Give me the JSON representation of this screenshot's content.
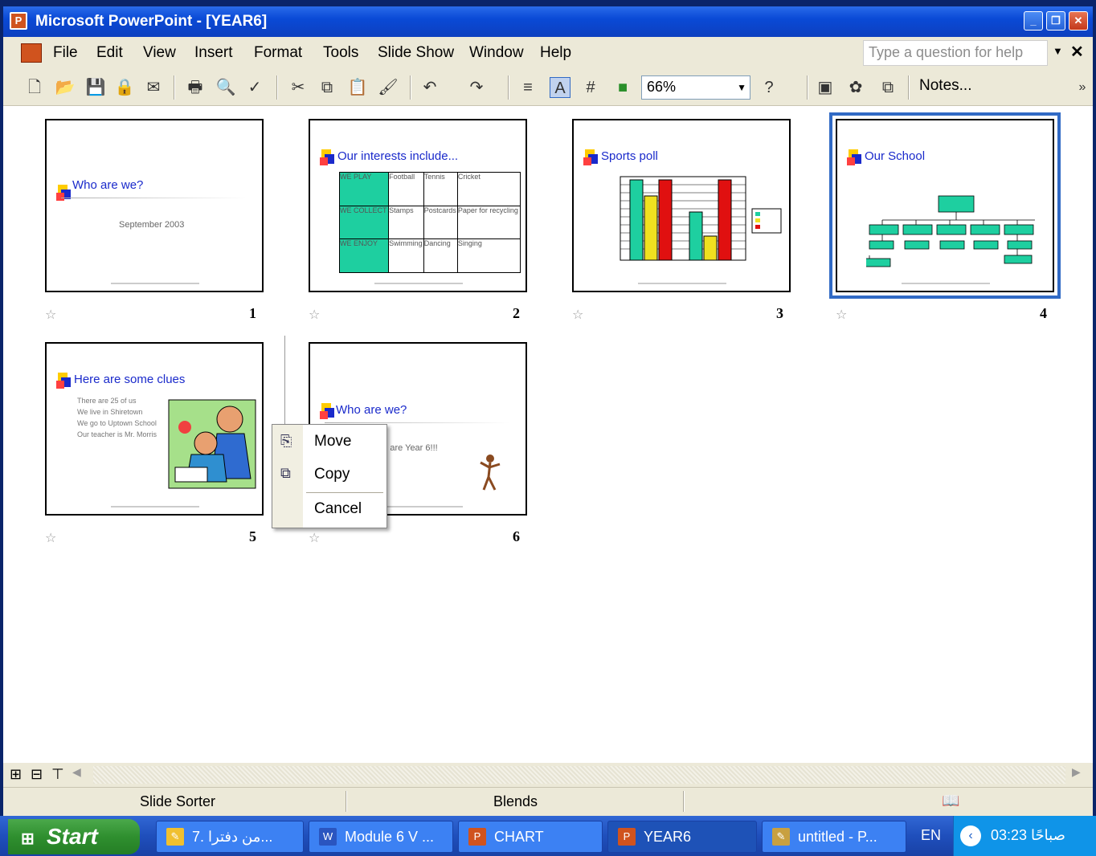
{
  "window": {
    "title": "Microsoft PowerPoint - [YEAR6]"
  },
  "menu": [
    "File",
    "Edit",
    "View",
    "Insert",
    "Format",
    "Tools",
    "Slide Show",
    "Window",
    "Help"
  ],
  "help": {
    "placeholder": "Type a question for help"
  },
  "toolbar": {
    "zoom": "66%",
    "notes_label": "Notes..."
  },
  "slides": [
    {
      "num": "1",
      "title": "Who are we?",
      "subtitle": "September 2003"
    },
    {
      "num": "2",
      "title": "Our interests include...",
      "table": [
        [
          "WE PLAY",
          "Football",
          "Tennis",
          "Cricket"
        ],
        [
          "WE COLLECT",
          "Stamps",
          "Postcards",
          "Paper for recycling"
        ],
        [
          "WE ENJOY",
          "Swimming",
          "Dancing",
          "Singing"
        ]
      ]
    },
    {
      "num": "3",
      "title": "Sports poll"
    },
    {
      "num": "4",
      "title": "Our School"
    },
    {
      "num": "5",
      "title": "Here are some clues",
      "bullets": [
        "There are 25 of us",
        "We live in Shiretown",
        "We go to Uptown School",
        "Our teacher is Mr. Morris"
      ]
    },
    {
      "num": "6",
      "title": "Who are we?",
      "subtitle": "We are Year 6!!!"
    }
  ],
  "context_menu": {
    "move": "Move",
    "copy": "Copy",
    "cancel": "Cancel"
  },
  "status": {
    "view": "Slide Sorter",
    "design": "Blends"
  },
  "taskbar": {
    "start": "Start",
    "tasks": [
      "7. من دفترا...",
      "Module 6 V ...",
      "CHART",
      "YEAR6",
      "untitled - P..."
    ],
    "lang": "EN",
    "clock": "03:23 صباحًا"
  },
  "colors": {
    "titlebar": "#0a4ad6",
    "accent": "#1a2acb",
    "table_fill": "#1ecfa0",
    "selection": "#316ac5"
  }
}
